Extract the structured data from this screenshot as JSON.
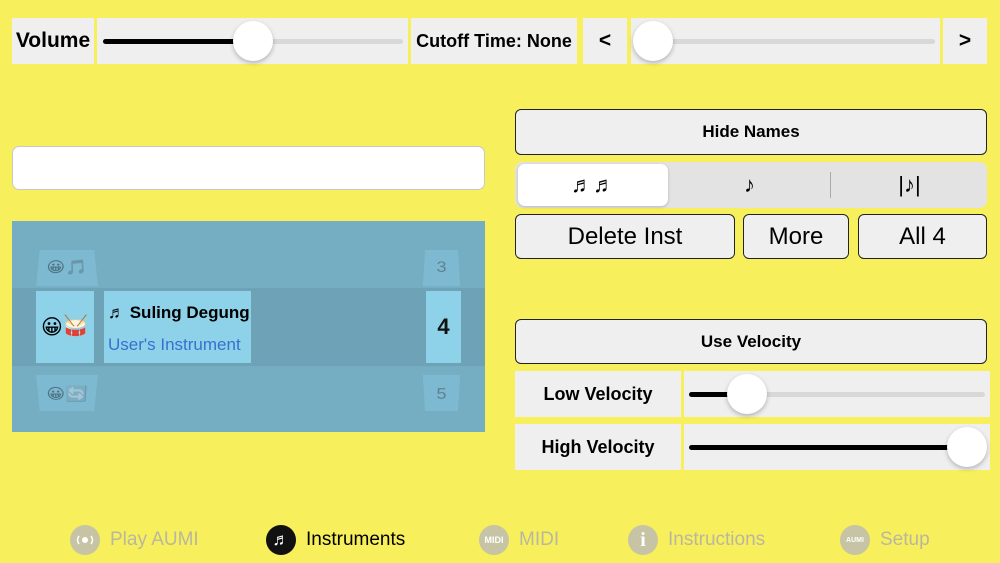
{
  "top_bar": {
    "volume_label": "Volume",
    "volume_value": 0.5,
    "cutoff_label": "Cutoff Time: None",
    "prev_label": "<",
    "next_label": ">",
    "cutoff_value": 0.0
  },
  "search": {
    "value": "",
    "placeholder": ""
  },
  "picker": {
    "rows": [
      {
        "emoji_left": "😀",
        "emoji_right": "🎵",
        "number": "3"
      },
      {
        "emoji_left": "😀",
        "emoji_right": "🥁",
        "name": "♬ Suling Degung",
        "subtitle": "User's Instrument",
        "number": "4"
      },
      {
        "emoji_left": "😀",
        "emoji_right": "🔄",
        "number": "5"
      }
    ]
  },
  "right_panel": {
    "hide_names_label": "Hide Names",
    "segments": [
      "♬♬",
      "♪",
      "|♪|"
    ],
    "selected_segment": 0,
    "delete_label": "Delete Inst",
    "more_label": "More",
    "all_label": "All 4",
    "use_velocity_label": "Use Velocity",
    "low_velocity_label": "Low Velocity",
    "low_velocity_value": 0.2,
    "high_velocity_label": "High Velocity",
    "high_velocity_value": 1.0
  },
  "tabs": [
    {
      "label": "Play AUMI",
      "icon": "speaker-icon",
      "icon_text": "",
      "active": false
    },
    {
      "label": "Instruments",
      "icon": "music-note-icon",
      "icon_text": "♬",
      "active": true
    },
    {
      "label": "MIDI",
      "icon": "midi-icon",
      "icon_text": "MIDI",
      "active": false
    },
    {
      "label": "Instructions",
      "icon": "info-icon",
      "icon_text": "i",
      "active": false
    },
    {
      "label": "Setup",
      "icon": "aumi-icon",
      "icon_text": "AUMI",
      "active": false
    }
  ],
  "colors": {
    "background": "#f7f05c",
    "picker": "#75adc3",
    "cell": "#8dd2e8",
    "subtitle": "#3a6fd0"
  }
}
